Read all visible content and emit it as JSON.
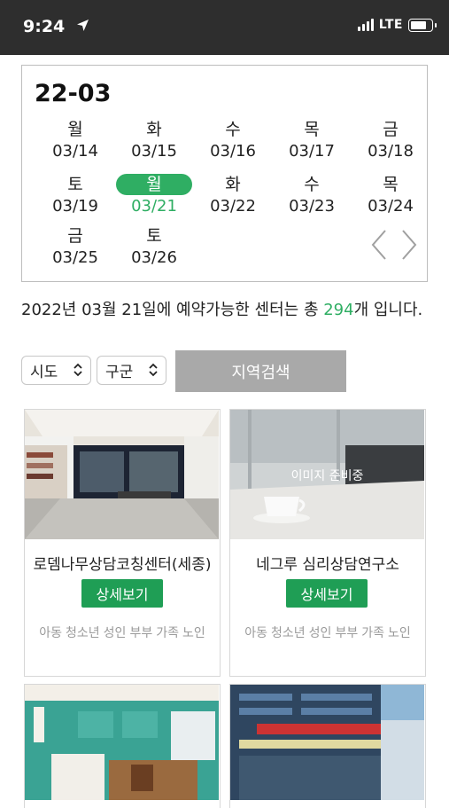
{
  "status_bar": {
    "time": "9:24",
    "network": "LTE"
  },
  "calendar": {
    "month": "22-03",
    "days": [
      {
        "dow": "월",
        "date": "03/14"
      },
      {
        "dow": "화",
        "date": "03/15"
      },
      {
        "dow": "수",
        "date": "03/16"
      },
      {
        "dow": "목",
        "date": "03/17"
      },
      {
        "dow": "금",
        "date": "03/18"
      },
      {
        "dow": "토",
        "date": "03/19"
      },
      {
        "dow": "월",
        "date": "03/21"
      },
      {
        "dow": "화",
        "date": "03/22"
      },
      {
        "dow": "수",
        "date": "03/23"
      },
      {
        "dow": "목",
        "date": "03/24"
      },
      {
        "dow": "금",
        "date": "03/25"
      },
      {
        "dow": "토",
        "date": "03/26"
      }
    ],
    "selected_index": 6,
    "selected_color": "#2fae63"
  },
  "summary": {
    "prefix": "2022년 03월 21일에 예약가능한 센터는 총 ",
    "count": "294",
    "suffix": "개 입니다."
  },
  "filters": {
    "sido": "시도",
    "gugun": "구군",
    "search_label": "지역검색"
  },
  "centers": [
    {
      "name": "로뎀나무상담코칭센터(세종)",
      "detail_label": "상세보기",
      "tags": [
        "아동",
        "청소년",
        "성인",
        "부부",
        "가족",
        "노인"
      ]
    },
    {
      "name": "네그루 심리상담연구소",
      "photo_caption": "이미지 준비중",
      "detail_label": "상세보기",
      "tags": [
        "아동",
        "청소년",
        "성인",
        "부부",
        "가족",
        "노인"
      ]
    }
  ],
  "accent_color": "#1f9e55"
}
